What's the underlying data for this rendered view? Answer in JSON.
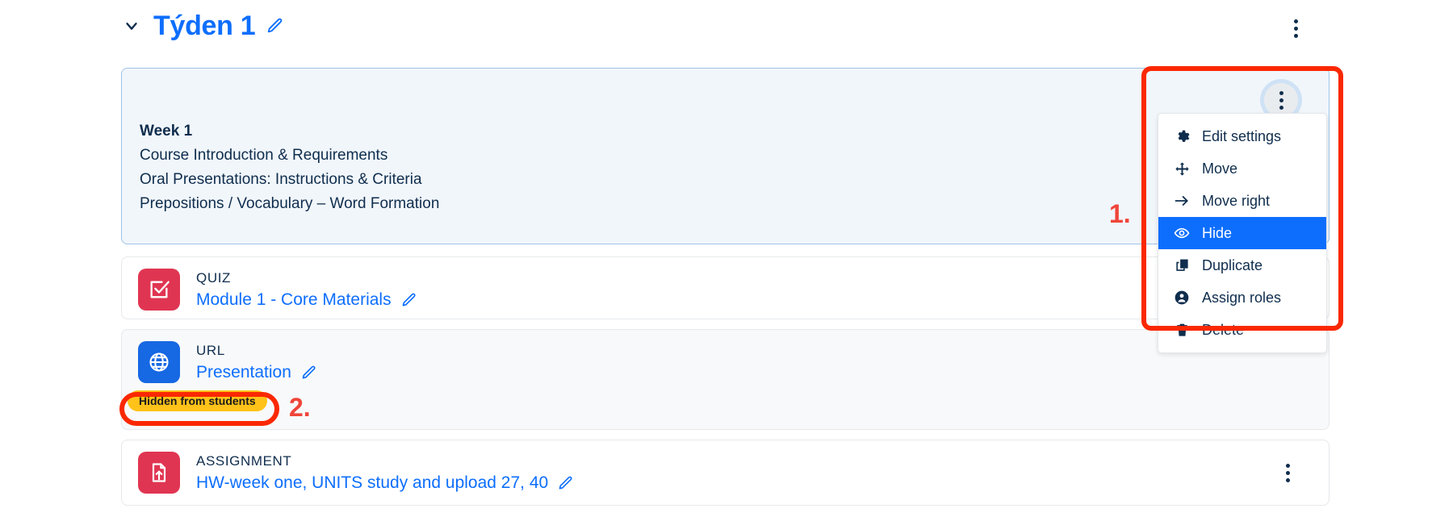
{
  "section": {
    "title": "Týden 1",
    "collapse_icon": "chevron-down-icon",
    "edit_icon": "pencil-icon",
    "kebab_icon": "kebab-menu-icon"
  },
  "summary": {
    "kebab_icon": "kebab-menu-icon",
    "lines": [
      "Week 1",
      "Course Introduction & Requirements",
      "Oral Presentations: Instructions & Criteria",
      "Prepositions / Vocabulary – Word Formation"
    ]
  },
  "dropdown": {
    "items": [
      {
        "label": "Edit settings",
        "icon": "gear-icon",
        "active": false
      },
      {
        "label": "Move",
        "icon": "move-arrows-icon",
        "active": false
      },
      {
        "label": "Move right",
        "icon": "arrow-right-icon",
        "active": false
      },
      {
        "label": "Hide",
        "icon": "eye-icon",
        "active": true
      },
      {
        "label": "Duplicate",
        "icon": "copy-icon",
        "active": false
      },
      {
        "label": "Assign roles",
        "icon": "person-icon",
        "active": false
      },
      {
        "label": "Delete",
        "icon": "trash-icon",
        "active": false
      }
    ]
  },
  "activities": [
    {
      "kind": "QUIZ",
      "name": "Module 1 - Core Materials",
      "icon": "quiz-checkbox-icon",
      "edit_icon": "pencil-icon",
      "badge": null,
      "kebab_icon": null
    },
    {
      "kind": "URL",
      "name": "Presentation",
      "icon": "globe-icon",
      "edit_icon": "pencil-icon",
      "badge": "Hidden from students",
      "kebab_icon": null
    },
    {
      "kind": "ASSIGNMENT",
      "name": "HW-week one, UNITS study and upload 27, 40",
      "icon": "assignment-upload-icon",
      "edit_icon": "pencil-icon",
      "badge": null,
      "kebab_icon": "kebab-menu-icon"
    }
  ],
  "annotations": [
    {
      "label": "1."
    },
    {
      "label": "2."
    }
  ],
  "colors": {
    "link_blue": "#0d6efd",
    "text_navy": "#0f2d4d",
    "summary_bg": "#f1f6fb",
    "summary_border": "#9fc3e8",
    "quiz_icon_bg": "#e03552",
    "url_icon_bg": "#1668e3",
    "badge_bg": "#ffc219",
    "annotation_red": "#fa2800",
    "menu_active_bg": "#0d6efd"
  }
}
